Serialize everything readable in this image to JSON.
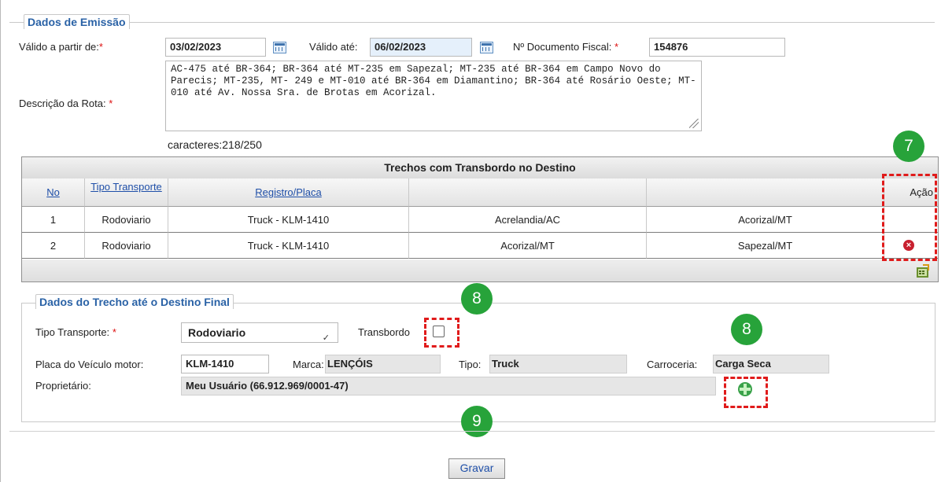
{
  "emission": {
    "legend": "Dados de Emissão",
    "valid_from_label": "Válido a partir de:",
    "valid_from_value": "03/02/2023",
    "valid_to_label": "Válido até:",
    "valid_to_value": "06/02/2023",
    "doc_label": "Nº Documento Fiscal:",
    "doc_value": "154876",
    "route_label": "Descrição da Rota:",
    "route_text": "AC-475 até BR-364; BR-364 até MT-235 em Sapezal; MT-235 até BR-364 em Campo Novo do Parecis; MT-235, MT- 249 e MT-010 até BR-364 em Diamantino; BR-364 até Rosário Oeste; MT-010 até Av. Nossa Sra. de Brotas em Acorizal.",
    "char_count": "caracteres:218/250"
  },
  "table": {
    "title": "Trechos com Transbordo no Destino",
    "headers": {
      "no": "No",
      "tipo": "Tipo Transporte",
      "registro": "Registro/Placa",
      "origem": "",
      "destino": "",
      "acao": "Ação"
    },
    "rows": [
      {
        "no": "1",
        "tipo": "Rodoviario",
        "registro": "Truck - KLM-1410",
        "origem": "Acrelandia/AC",
        "destino": "Acorizal/MT"
      },
      {
        "no": "2",
        "tipo": "Rodoviario",
        "registro": "Truck - KLM-1410",
        "origem": "Acorizal/MT",
        "destino": "Sapezal/MT"
      }
    ]
  },
  "badges": {
    "b7": "7",
    "b8a": "8",
    "b8b": "8",
    "b9": "9"
  },
  "final": {
    "legend": "Dados do Trecho até o Destino Final",
    "tipo_label": "Tipo Transporte:",
    "tipo_value": "Rodoviario",
    "transbordo_label": "Transbordo",
    "transbordo_checked": false,
    "placa_label": "Placa do Veículo motor:",
    "placa_value": "KLM-1410",
    "marca_label": "Marca:",
    "marca_value": "LENÇÓIS",
    "tipo2_label": "Tipo:",
    "tipo2_value": "Truck",
    "carroceria_label": "Carroceria:",
    "carroceria_value": "Carga Seca",
    "proprietario_label": "Proprietário:",
    "proprietario_value": "Meu Usuário (66.912.969/0001-47)"
  },
  "actions": {
    "save_label": "Gravar"
  },
  "colors": {
    "badge": "#27a33a",
    "highlight": "#e01b1b",
    "link": "#1f4fa8",
    "legend": "#2a62a6"
  }
}
